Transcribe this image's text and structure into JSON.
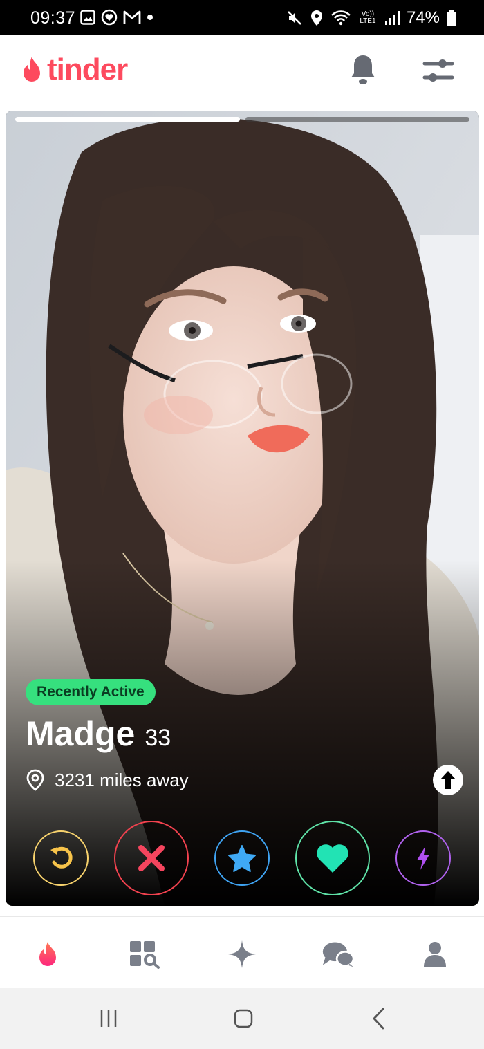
{
  "status_bar": {
    "time": "09:37",
    "network_label": "Vo)) LTE1",
    "battery_percent": "74%",
    "left_icons": [
      "gallery-icon",
      "heart-circle-icon",
      "gmail-icon",
      "dot-icon"
    ],
    "right_icons": [
      "mute-icon",
      "location-icon",
      "wifi-icon",
      "signal-icon",
      "battery-icon"
    ]
  },
  "header": {
    "logo_text": "tinder",
    "brand_color": "#fd4a5e",
    "icons": [
      "notification-bell-icon",
      "filter-sliders-icon"
    ]
  },
  "card": {
    "photo_count": 2,
    "current_photo_index": 1,
    "badge": "Recently Active",
    "badge_color": "#36e07e",
    "name": "Madge",
    "age": "33",
    "distance": "3231 miles away",
    "actions": [
      {
        "name": "rewind",
        "icon": "rewind-icon",
        "color": "#f7d26d"
      },
      {
        "name": "nope",
        "icon": "close-x-icon",
        "color": "#f3424f"
      },
      {
        "name": "super-like",
        "icon": "star-icon",
        "color": "#3fa3f2"
      },
      {
        "name": "like",
        "icon": "heart-icon",
        "color": "#5fe3a8"
      },
      {
        "name": "boost",
        "icon": "lightning-icon",
        "color": "#b062ee"
      }
    ]
  },
  "bottom_nav": {
    "items": [
      {
        "name": "swipe",
        "icon": "flame-icon",
        "active": true
      },
      {
        "name": "explore",
        "icon": "explore-grid-icon",
        "active": false
      },
      {
        "name": "gold",
        "icon": "sparkle-icon",
        "active": false
      },
      {
        "name": "messages",
        "icon": "chat-bubbles-icon",
        "active": false
      },
      {
        "name": "profile",
        "icon": "person-icon",
        "active": false
      }
    ]
  },
  "system_nav": {
    "buttons": [
      "recent-apps-icon",
      "home-icon",
      "back-icon"
    ]
  }
}
